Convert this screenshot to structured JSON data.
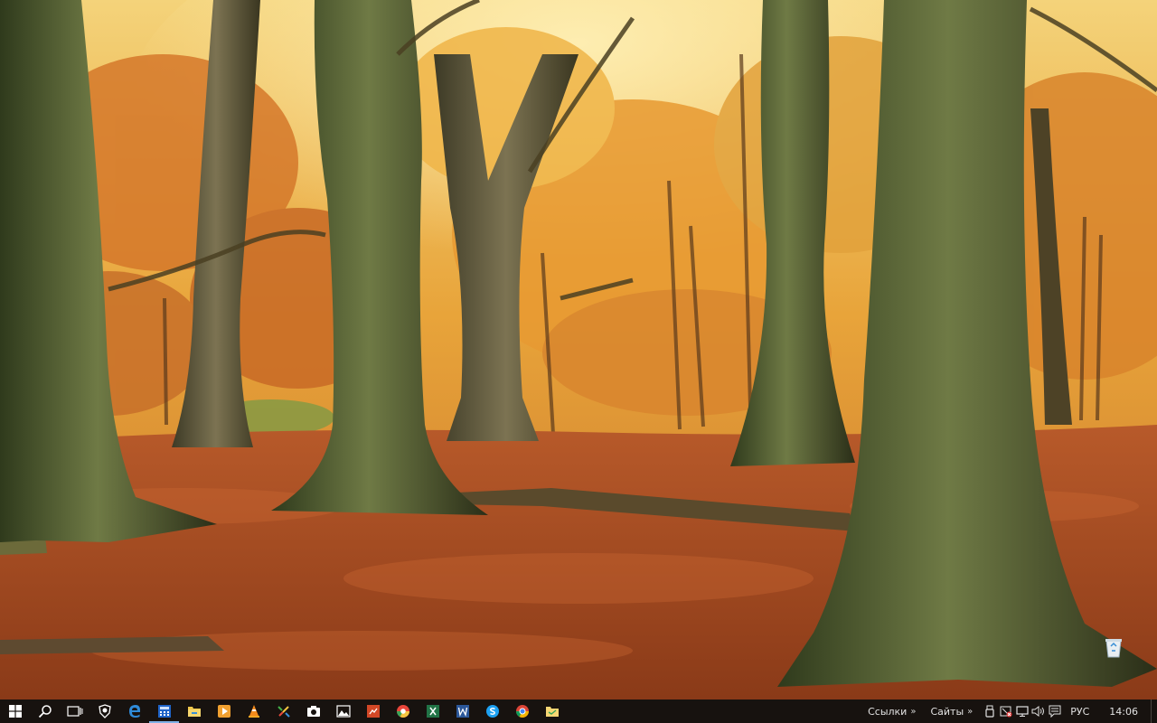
{
  "desktop": {
    "wallpaper": "autumn-beech-forest",
    "icons": [
      {
        "name": "recycle-bin-icon"
      }
    ]
  },
  "taskbar": {
    "background": "#17120f",
    "start_icon": "windows-logo-icon",
    "search_icon": "search-icon",
    "task_view_icon": "task-view-icon",
    "pinned_apps": [
      "shield-app-icon",
      "edge-browser-icon",
      "calculator-app-icon",
      "file-explorer-icon",
      "media-player-icon",
      "vlc-icon",
      "paint-app-icon",
      "camera-app-icon",
      "photos-app-icon",
      "presentation-app-icon",
      "chrome-like-icon",
      "spreadsheet-app-icon",
      "word-app-icon",
      "skype-icon",
      "chrome-icon",
      "folder-app-icon"
    ],
    "toolbars": [
      {
        "label": "Ссылки",
        "chevron": "»"
      },
      {
        "label": "Сайты",
        "chevron": "»"
      }
    ],
    "tray_icons": [
      "usb-icon",
      "security-alert-icon",
      "network-icon",
      "volume-icon",
      "notification-icon"
    ],
    "language": "РУС",
    "clock": "14:06"
  }
}
